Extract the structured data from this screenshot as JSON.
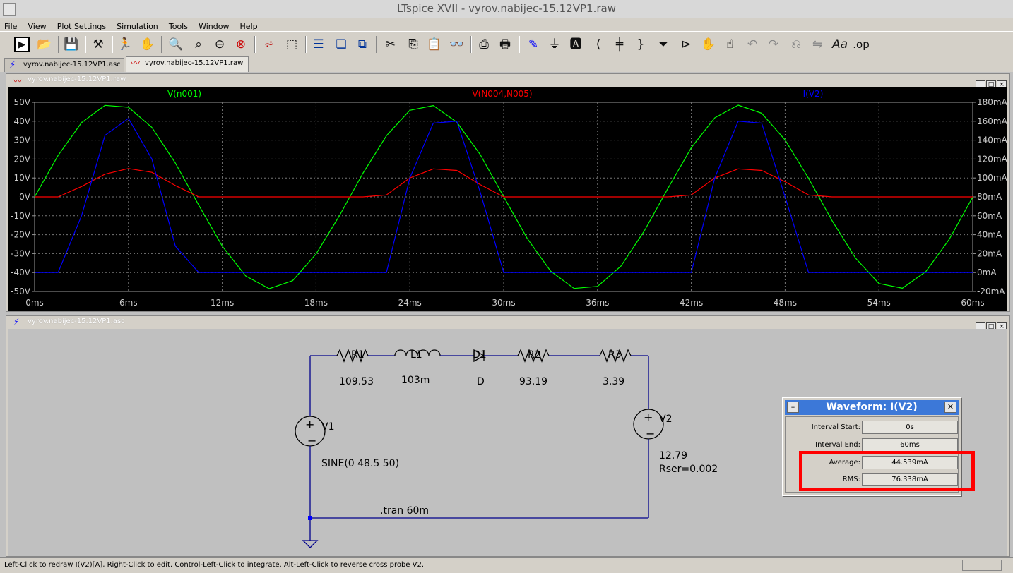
{
  "app": {
    "title": "LTspice XVII - vyrov.nabijec-15.12VP1.raw",
    "sys_icon": "minus-icon"
  },
  "menu": [
    "File",
    "View",
    "Plot Settings",
    "Simulation",
    "Tools",
    "Window",
    "Help"
  ],
  "toolbar": {
    "icons": [
      "run-icon",
      "open-icon",
      "save-icon",
      "control-panel-icon",
      "halt-icon",
      "pan-icon",
      "zoom-in-icon",
      "zoom-area-icon",
      "zoom-out-icon",
      "zoom-fit-icon",
      "tile-waveforms-icon",
      "autorange-icon",
      "tile-horizontal-icon",
      "cascade-icon",
      "tile-windows-icon",
      "cut-icon",
      "copy-icon",
      "paste-icon",
      "find-icon",
      "print-setup-icon",
      "print-icon",
      "wire-icon",
      "ground-icon",
      "label-icon",
      "resistor-icon",
      "capacitor-icon",
      "inductor-icon",
      "diode-icon",
      "component-icon",
      "move-icon",
      "drag-icon",
      "undo-icon",
      "redo-icon",
      "rotate-icon",
      "mirror-icon",
      "text-icon",
      "spice-directive-icon"
    ],
    "op_label": ".op",
    "text_label": "Aa"
  },
  "tabs": [
    {
      "label": "vyrov.nabijec-15.12VP1.asc",
      "icon": "schematic-icon",
      "active": false
    },
    {
      "label": "vyrov.nabijec-15.12VP1.raw",
      "icon": "waveform-icon",
      "active": true
    }
  ],
  "plot_window": {
    "title": "vyrov.nabijec-15.12VP1.raw"
  },
  "schematic_window": {
    "title": "vyrov.nabijec-15.12VP1.asc"
  },
  "window_buttons": [
    "_",
    "□",
    "×"
  ],
  "chart_data": {
    "type": "line",
    "x": [
      0,
      1.5,
      3,
      4.5,
      6,
      7.5,
      9,
      10.5,
      12,
      13.5,
      15,
      16.5,
      18,
      19.5,
      21,
      22.5,
      24,
      25.5,
      27,
      28.5,
      30,
      31.5,
      33,
      34.5,
      36,
      37.5,
      39,
      40.5,
      42,
      43.5,
      45,
      46.5,
      48,
      49.5,
      51,
      52.5,
      54,
      55.5,
      57,
      58.5,
      60
    ],
    "xlabel": "",
    "ylabel_left": "",
    "ylabel_right": "",
    "xlim": [
      0,
      60
    ],
    "x_ticks": [
      "0ms",
      "6ms",
      "12ms",
      "18ms",
      "24ms",
      "30ms",
      "36ms",
      "42ms",
      "48ms",
      "54ms",
      "60ms"
    ],
    "ylim_left": [
      -50,
      50
    ],
    "y_ticks_left": [
      "50V",
      "40V",
      "30V",
      "20V",
      "10V",
      "0V",
      "-10V",
      "-20V",
      "-30V",
      "-40V",
      "-50V"
    ],
    "ylim_right": [
      -20,
      180
    ],
    "y_ticks_right": [
      "180mA",
      "160mA",
      "140mA",
      "120mA",
      "100mA",
      "80mA",
      "60mA",
      "40mA",
      "20mA",
      "0mA",
      "-20mA"
    ],
    "grid": true,
    "series": [
      {
        "name": "V(n001)",
        "color": "#00ff00",
        "axis": "left",
        "values": [
          0,
          21.9,
          39.2,
          48.4,
          47.4,
          36.7,
          17.9,
          -4.4,
          -26.0,
          -41.8,
          -48.5,
          -44.3,
          -30.2,
          -9.9,
          12.5,
          32.3,
          45.8,
          48.3,
          39.5,
          22.4,
          0.1,
          -21.9,
          -39.2,
          -48.4,
          -47.3,
          -36.6,
          -17.9,
          4.4,
          26.0,
          41.8,
          48.5,
          44.2,
          30.1,
          9.8,
          -12.5,
          -32.3,
          -45.8,
          -48.3,
          -39.5,
          -22.4,
          -0.1
        ]
      },
      {
        "name": "V(N004,N005)",
        "color": "#ff0000",
        "axis": "left",
        "values": [
          0,
          0,
          5.5,
          12.0,
          15.0,
          13.0,
          6.0,
          0,
          0,
          0,
          0,
          0,
          0,
          0,
          0,
          1.0,
          10.0,
          14.8,
          14.0,
          6.5,
          0,
          0,
          0,
          0,
          0,
          0,
          0,
          0,
          1.0,
          10.0,
          14.8,
          14.0,
          8.0,
          1.0,
          0,
          0,
          0,
          0,
          0,
          0,
          0
        ]
      },
      {
        "name": "I(V2)",
        "color": "#0000ff",
        "axis": "right",
        "values": [
          0,
          0,
          60,
          145,
          163,
          120,
          28,
          0,
          0,
          0,
          0,
          0,
          0,
          0,
          0,
          0,
          100,
          158,
          160,
          85,
          0,
          0,
          0,
          0,
          0,
          0,
          0,
          0,
          0,
          100,
          160,
          158,
          80,
          0,
          0,
          0,
          0,
          0,
          0,
          0,
          0
        ]
      }
    ]
  },
  "schematic": {
    "components": [
      {
        "ref": "R1",
        "value": "109.53"
      },
      {
        "ref": "L1",
        "value": "103m"
      },
      {
        "ref": "D1",
        "value": "D"
      },
      {
        "ref": "R2",
        "value": "93.19"
      },
      {
        "ref": "R3",
        "value": "3.39"
      },
      {
        "ref": "V1",
        "value": "SINE(0 48.5 50)"
      },
      {
        "ref": "V2",
        "value": "12.79",
        "extra": "Rser=0.002"
      }
    ],
    "directive": ".tran 60m"
  },
  "waveform_dialog": {
    "title": "Waveform: I(V2)",
    "min_btn": "–",
    "close_btn": "✕",
    "rows": [
      {
        "label": "Interval Start:",
        "value": "0s"
      },
      {
        "label": "Interval End:",
        "value": "60ms"
      },
      {
        "label": "Average:",
        "value": "44.539mA"
      },
      {
        "label": "RMS:",
        "value": "76.338mA"
      }
    ],
    "highlight_color": "#ff0000"
  },
  "status": {
    "text": "Left-Click to redraw I(V2)[A], Right-Click to edit. Control-Left-Click to integrate. Alt-Left-Click to reverse cross probe V2."
  }
}
